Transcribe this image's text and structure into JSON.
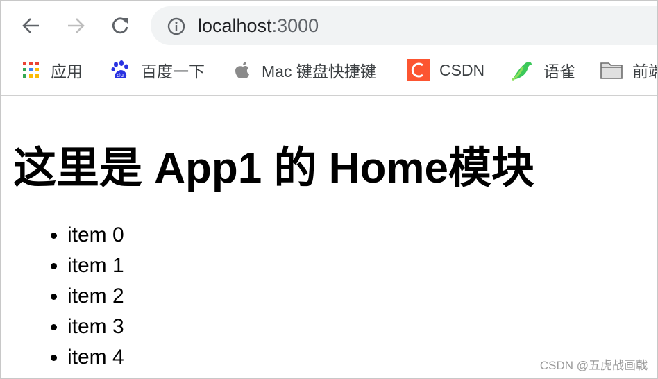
{
  "browser": {
    "url_host": "localhost",
    "url_port": ":3000",
    "bookmarks": [
      {
        "label": "应用",
        "icon": "apps-grid-icon"
      },
      {
        "label": "百度一下",
        "icon": "baidu-paw-icon"
      },
      {
        "label": "Mac 键盘快捷键",
        "icon": "apple-icon"
      },
      {
        "label": "CSDN",
        "icon": "csdn-icon"
      },
      {
        "label": "语雀",
        "icon": "yuque-bird-icon"
      },
      {
        "label": "前端",
        "icon": "folder-icon"
      }
    ]
  },
  "page": {
    "title": "这里是 App1 的 Home模块",
    "items": [
      "item 0",
      "item 1",
      "item 2",
      "item 3",
      "item 4"
    ]
  },
  "watermark": "CSDN @五虎战画戟",
  "colors": {
    "csdn": "#fc5531",
    "baidu": "#2932e1",
    "yuque": "#3cc85a"
  }
}
